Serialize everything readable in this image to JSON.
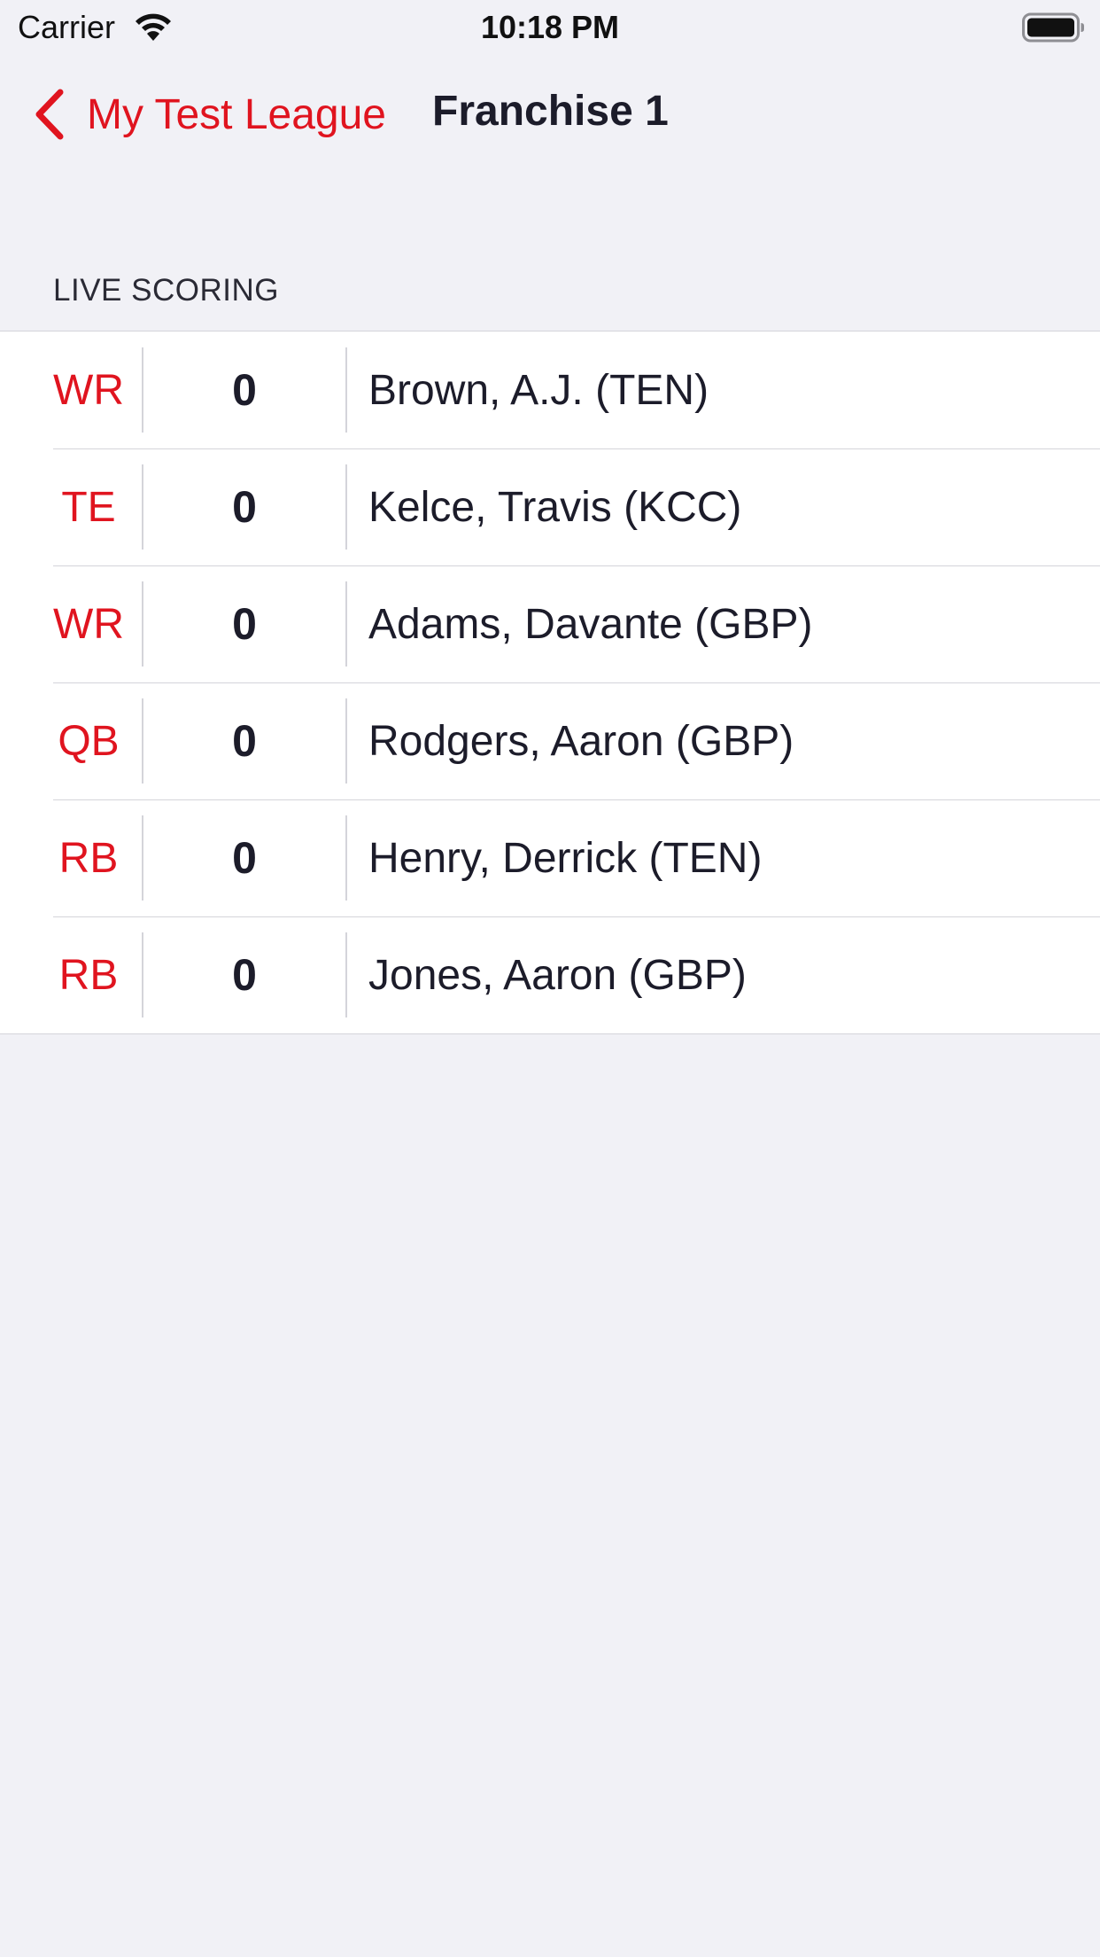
{
  "status_bar": {
    "carrier": "Carrier",
    "time": "10:18 PM"
  },
  "nav": {
    "back_label": "My Test League",
    "title": "Franchise 1"
  },
  "section": {
    "header": "LIVE SCORING"
  },
  "rows": [
    {
      "position": "WR",
      "score": "0",
      "player": "Brown, A.J. (TEN)"
    },
    {
      "position": "TE",
      "score": "0",
      "player": "Kelce, Travis (KCC)"
    },
    {
      "position": "WR",
      "score": "0",
      "player": "Adams, Davante (GBP)"
    },
    {
      "position": "QB",
      "score": "0",
      "player": "Rodgers, Aaron (GBP)"
    },
    {
      "position": "RB",
      "score": "0",
      "player": "Henry, Derrick (TEN)"
    },
    {
      "position": "RB",
      "score": "0",
      "player": "Jones, Aaron (GBP)"
    }
  ],
  "colors": {
    "accent": "#e0141f",
    "background": "#f1f1f6",
    "text": "#1c1c2a"
  }
}
